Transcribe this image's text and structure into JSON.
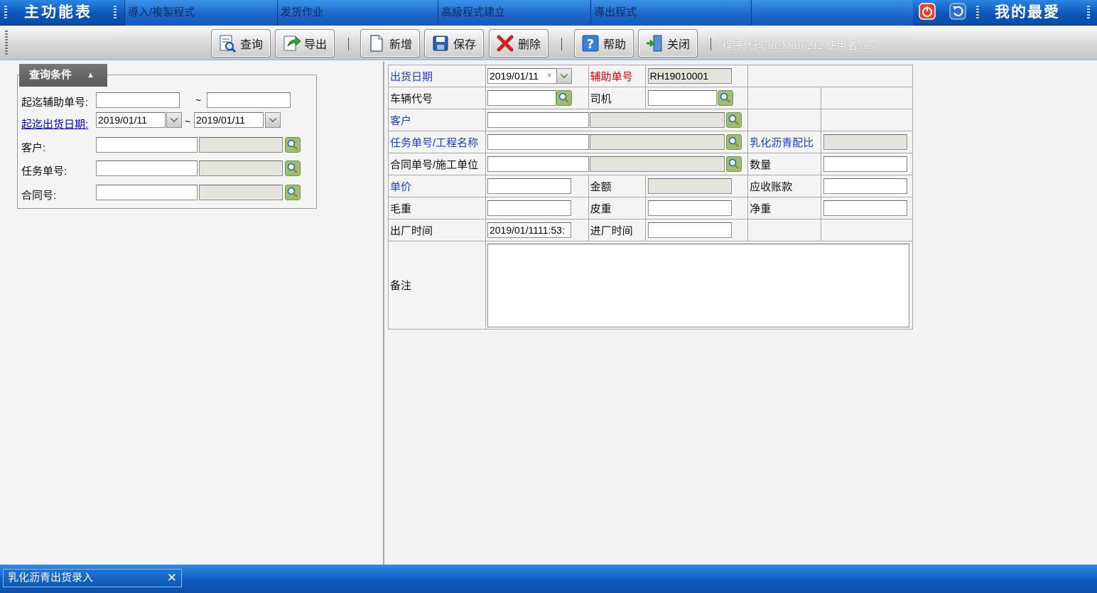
{
  "topbar": {
    "main_menu": "主功能表",
    "tabs": [
      "導入/複製程式",
      "发货作业",
      "高級程式建立",
      "導出程式",
      ""
    ],
    "favorites": "我的最愛",
    "icons": [
      "power-icon",
      "refresh-icon"
    ]
  },
  "toolbar": {
    "query": "查询",
    "export": "导出",
    "add": "新增",
    "save": "保存",
    "delete": "删除",
    "help": "帮助",
    "close": "关闭",
    "program_info": "程序代码:RCM010212  使用者:ois"
  },
  "query": {
    "tab_label": "查询条件",
    "caret": "▲",
    "aux_no_label": "起迄辅助单号:",
    "ship_date_label": "起迄出货日期:",
    "ship_date_from": "2019/01/11",
    "ship_date_to": "2019/01/11",
    "tilde": "~",
    "customer_label": "客户:",
    "task_no_label": "任务单号:",
    "contract_no_label": "合同号:"
  },
  "form": {
    "ship_date_label": "出货日期",
    "ship_date_value": "2019/01/11",
    "aux_no_label": "辅助单号",
    "aux_no_value": "RH19010001",
    "vehicle_label": "车辆代号",
    "driver_label": "司机",
    "customer_label": "客户",
    "task_label": "任务单号/工程名称",
    "ratio_label": "乳化沥青配比",
    "contract_label": "合同单号/施工单位",
    "quantity_label": "数量",
    "unit_price_label": "单价",
    "amount_label": "金额",
    "receivable_label": "应收账款",
    "gross_label": "毛重",
    "tare_label": "皮重",
    "net_label": "净重",
    "exit_time_label": "出厂时间",
    "exit_time_value": "2019/01/1111:53:",
    "enter_time_label": "进厂时间",
    "remark_label": "备注"
  },
  "bottom": {
    "tab_label": "乳化沥青出货录入",
    "close_glyph": "✕"
  },
  "colors": {
    "bar_blue": "#0d5cc0",
    "link_blue": "#1b3fd6",
    "required_red": "#e00000"
  }
}
